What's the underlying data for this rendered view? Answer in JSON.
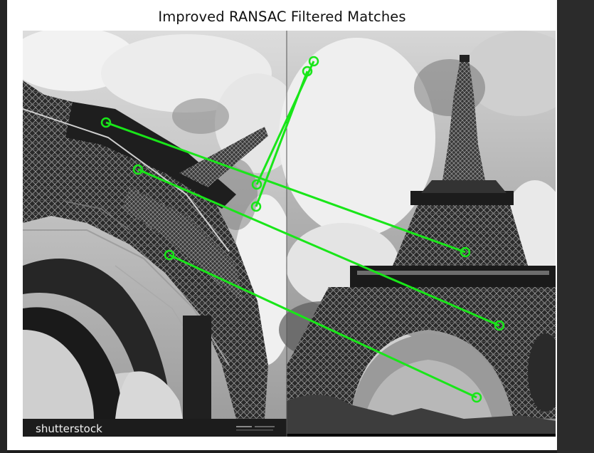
{
  "figure": {
    "title": "Improved RANSAC Filtered Matches"
  },
  "left_image": {
    "watermark": "shutterstock",
    "brand_bar_color": "#1c1c1c"
  },
  "right_image": {
    "bottom_bar_color": "#050505"
  },
  "match_color": "#19e619",
  "matches_count_shown": 5
}
